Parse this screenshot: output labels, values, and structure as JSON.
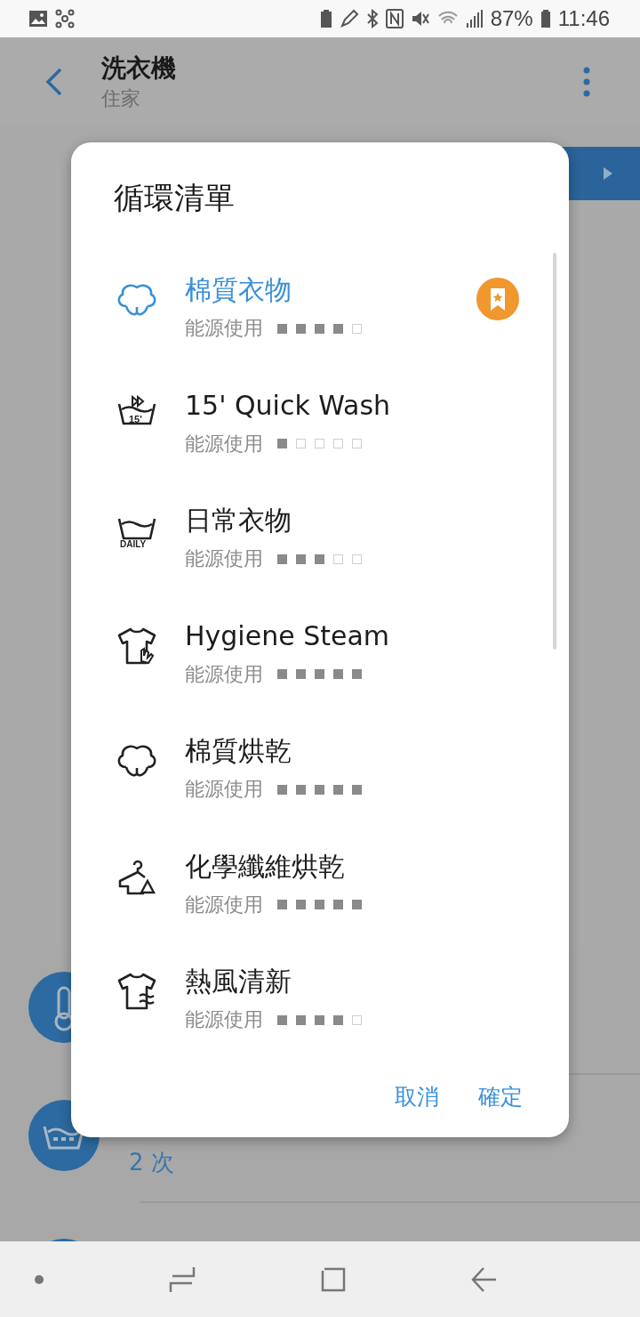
{
  "status_bar": {
    "battery_percent": "87%",
    "time": "11:46"
  },
  "header": {
    "title": "洗衣機",
    "subtitle": "住家"
  },
  "page": {
    "repeat_count": "2 次"
  },
  "dialog": {
    "title": "循環清單",
    "items": [
      {
        "kind": "cotton",
        "name": "棉質衣物",
        "energy_label": "能源使用",
        "stars": 4,
        "selected": true,
        "favorite": true
      },
      {
        "kind": "quick-wash",
        "icon_label": "15'",
        "name": "15' Quick Wash",
        "energy_label": "能源使用",
        "stars": 1,
        "selected": false,
        "favorite": false
      },
      {
        "kind": "daily",
        "icon_label": "DAILY",
        "name": "日常衣物",
        "energy_label": "能源使用",
        "stars": 3,
        "selected": false,
        "favorite": false
      },
      {
        "kind": "steam-shirt",
        "name": "Hygiene Steam",
        "energy_label": "能源使用",
        "stars": 5,
        "selected": false,
        "favorite": false
      },
      {
        "kind": "cotton",
        "name": "棉質烘乾",
        "energy_label": "能源使用",
        "stars": 5,
        "selected": false,
        "favorite": false
      },
      {
        "kind": "hanger",
        "name": "化學纖維烘乾",
        "energy_label": "能源使用",
        "stars": 5,
        "selected": false,
        "favorite": false
      },
      {
        "kind": "air-shirt",
        "name": "熱風清新",
        "energy_label": "能源使用",
        "stars": 4,
        "selected": false,
        "favorite": false
      }
    ],
    "buttons": [
      "取消",
      "確定"
    ]
  }
}
